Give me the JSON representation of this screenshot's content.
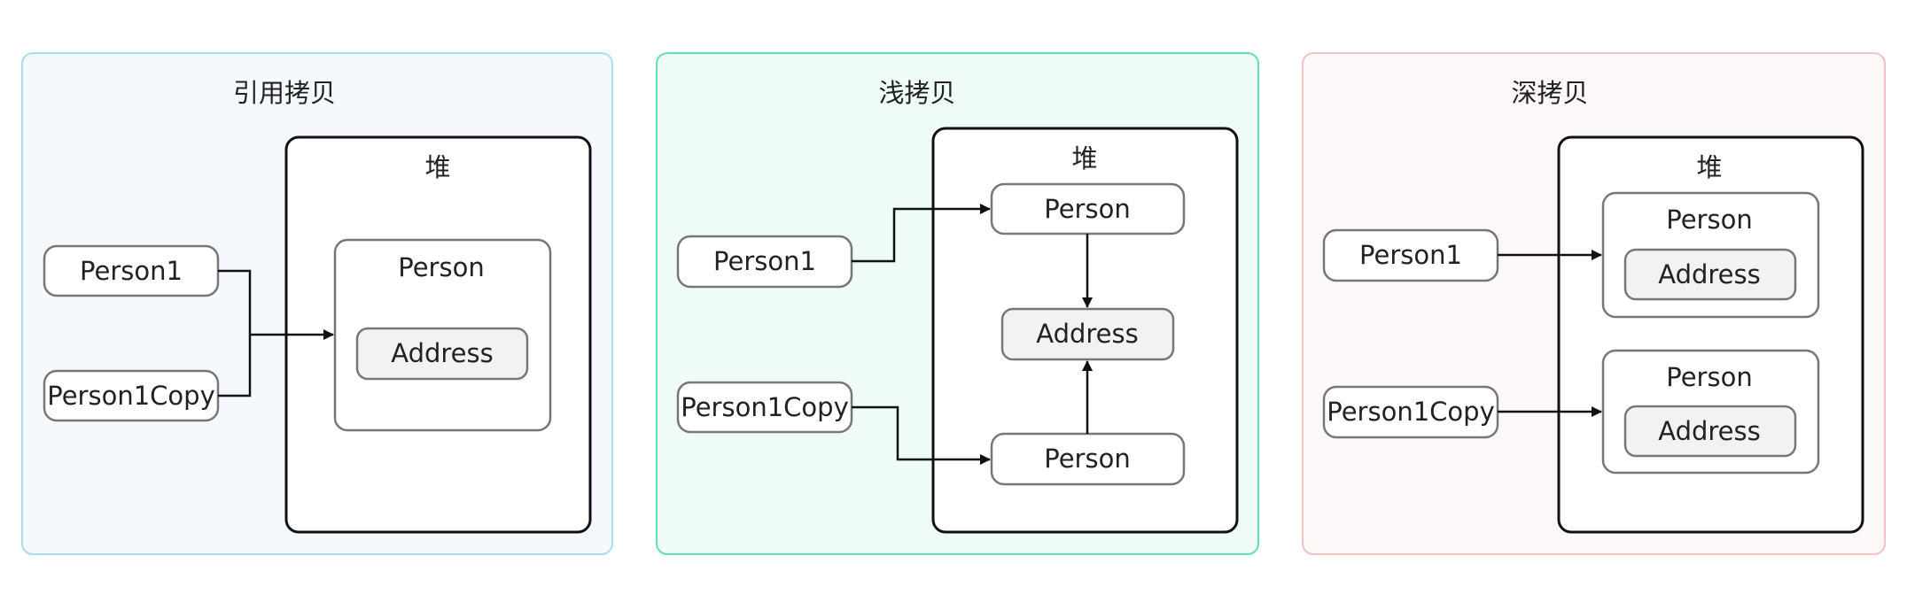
{
  "colors": {
    "panel_reference_border": "#a8dcf2",
    "panel_reference_fill": "#f5f9fd",
    "panel_shallow_border": "#5fe0b4",
    "panel_shallow_fill": "#effbf6",
    "panel_deep_border": "#f4c2c2",
    "panel_deep_fill": "#fdf8f8",
    "heap_border": "#111111",
    "node_border": "#777777",
    "address_fill": "#f2f2f2",
    "arrow": "#111111"
  },
  "panels": {
    "reference": {
      "title": "引用拷贝",
      "heap_title": "堆",
      "person1": "Person1",
      "person1copy": "Person1Copy",
      "person": "Person",
      "address": "Address"
    },
    "shallow": {
      "title": "浅拷贝",
      "heap_title": "堆",
      "person1": "Person1",
      "person1copy": "Person1Copy",
      "person_top": "Person",
      "person_bottom": "Person",
      "address": "Address"
    },
    "deep": {
      "title": "深拷贝",
      "heap_title": "堆",
      "person1": "Person1",
      "person1copy": "Person1Copy",
      "person_top": "Person",
      "address_top": "Address",
      "person_bottom": "Person",
      "address_bottom": "Address"
    }
  }
}
